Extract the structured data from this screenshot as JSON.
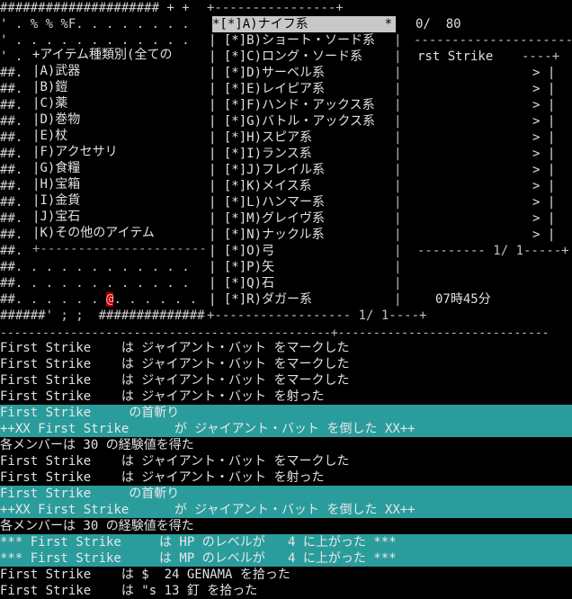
{
  "map": {
    "rows": [
      "##################### + +",
      "' . % % %F. . . . . . . .",
      "' . . . . . . . . . . . .",
      "' .",
      "##.",
      "##.",
      "##.",
      "##.",
      "##.",
      "##.",
      "##.",
      "##.",
      "##.",
      "##.",
      "##.",
      "##.",
      "##. . . . . . . . . . . .",
      "##. . . . . . . . . . . .",
      "##. . . . . . ",
      "######' ; ;  ###############"
    ],
    "player_glyph": "@",
    "player_suffix": ". . . . . ."
  },
  "type_menu": {
    "title": "+アイテム種類別(全ての",
    "items": [
      {
        "key": "A)",
        "label": "武器"
      },
      {
        "key": "B)",
        "label": "鎧"
      },
      {
        "key": "C)",
        "label": "薬"
      },
      {
        "key": "D)",
        "label": "巻物"
      },
      {
        "key": "E)",
        "label": "杖"
      },
      {
        "key": "F)",
        "label": "アクセサリ"
      },
      {
        "key": "G)",
        "label": "食糧"
      },
      {
        "key": "H)",
        "label": "宝箱"
      },
      {
        "key": "I)",
        "label": "金貨"
      },
      {
        "key": "J)",
        "label": "宝石"
      },
      {
        "key": "K)",
        "label": "その他のアイテム"
      }
    ],
    "bottom_border": "+------------------------"
  },
  "item_list": {
    "top_border": "+----------------+",
    "items": [
      {
        "mark": "*[*]",
        "key": "A)",
        "label": "ナイフ系",
        "selected": true,
        "suffix": "*"
      },
      {
        "mark": "[*]",
        "key": "B)",
        "label": "ショート・ソード系"
      },
      {
        "mark": "[*]",
        "key": "C)",
        "label": "ロング・ソード系"
      },
      {
        "mark": "[*]",
        "key": "D)",
        "label": "サーベル系"
      },
      {
        "mark": "[*]",
        "key": "E)",
        "label": "レイピア系"
      },
      {
        "mark": "[*]",
        "key": "F)",
        "label": "ハンド・アックス系"
      },
      {
        "mark": "[*]",
        "key": "G)",
        "label": "バトル・アックス系"
      },
      {
        "mark": "[*]",
        "key": "H)",
        "label": "スピア系"
      },
      {
        "mark": "[*]",
        "key": "I)",
        "label": "ランス系"
      },
      {
        "mark": "[*]",
        "key": "J)",
        "label": "フレイル系"
      },
      {
        "mark": "[*]",
        "key": "K)",
        "label": "メイス系"
      },
      {
        "mark": "[*]",
        "key": "L)",
        "label": "ハンマー系"
      },
      {
        "mark": "[*]",
        "key": "M)",
        "label": "グレイヴ系"
      },
      {
        "mark": "[*]",
        "key": "N)",
        "label": "ナックル系"
      },
      {
        "mark": "[*]",
        "key": "O)",
        "label": "弓"
      },
      {
        "mark": "[*]",
        "key": "P)",
        "label": "矢"
      },
      {
        "mark": "[*]",
        "key": "Q)",
        "label": "石"
      },
      {
        "mark": "[*]",
        "key": "R)",
        "label": "ダガー系"
      }
    ],
    "bottom_border": "+------------------ 1/ 1----+"
  },
  "right_panel": {
    "counter": "0/  80",
    "divider": "------------------------",
    "party_name": "rst Strike",
    "party_suffix": "----+",
    "rows": [
      "> |",
      "> |",
      "> |",
      "> |",
      "> |",
      "> |",
      "> |",
      "> |",
      "> |",
      "> |",
      "> |",
      "> |"
    ],
    "page_indicator": "--------- 1/ 1-----+",
    "time": "07時45分"
  },
  "separator": "-----------------------------------------------+------------------------------",
  "log": [
    {
      "text": "First Strike    は ジャイアント・バット をマークした",
      "highlight": false
    },
    {
      "text": "First Strike    は ジャイアント・バット をマークした",
      "highlight": false
    },
    {
      "text": "First Strike    は ジャイアント・バット をマークした",
      "highlight": false
    },
    {
      "text": "First Strike    は ジャイアント・バット を射った",
      "highlight": false
    },
    {
      "text": "First Strike     の首斬り",
      "highlight": true
    },
    {
      "text": "++XX First Strike      が ジャイアント・バット を倒した XX++",
      "highlight": true
    },
    {
      "text": "各メンバーは 30 の経験値を得た",
      "highlight": false
    },
    {
      "text": "First Strike    は ジャイアント・バット をマークした",
      "highlight": false
    },
    {
      "text": "First Strike    は ジャイアント・バット を射った",
      "highlight": false
    },
    {
      "text": "First Strike     の首斬り",
      "highlight": true
    },
    {
      "text": "++XX First Strike      が ジャイアント・バット を倒した XX++",
      "highlight": true
    },
    {
      "text": "各メンバーは 30 の経験値を得た",
      "highlight": false
    },
    {
      "text": "*** First Strike     は HP のレベルが   4 に上がった ***",
      "highlight": true
    },
    {
      "text": "*** First Strike     は MP のレベルが   4 に上がった ***",
      "highlight": true
    },
    {
      "text": "First Strike    は $  24 GENAMA を拾った",
      "highlight": false
    },
    {
      "text": "First Strike    は \"s 13 釘 を拾った",
      "highlight": false
    }
  ]
}
